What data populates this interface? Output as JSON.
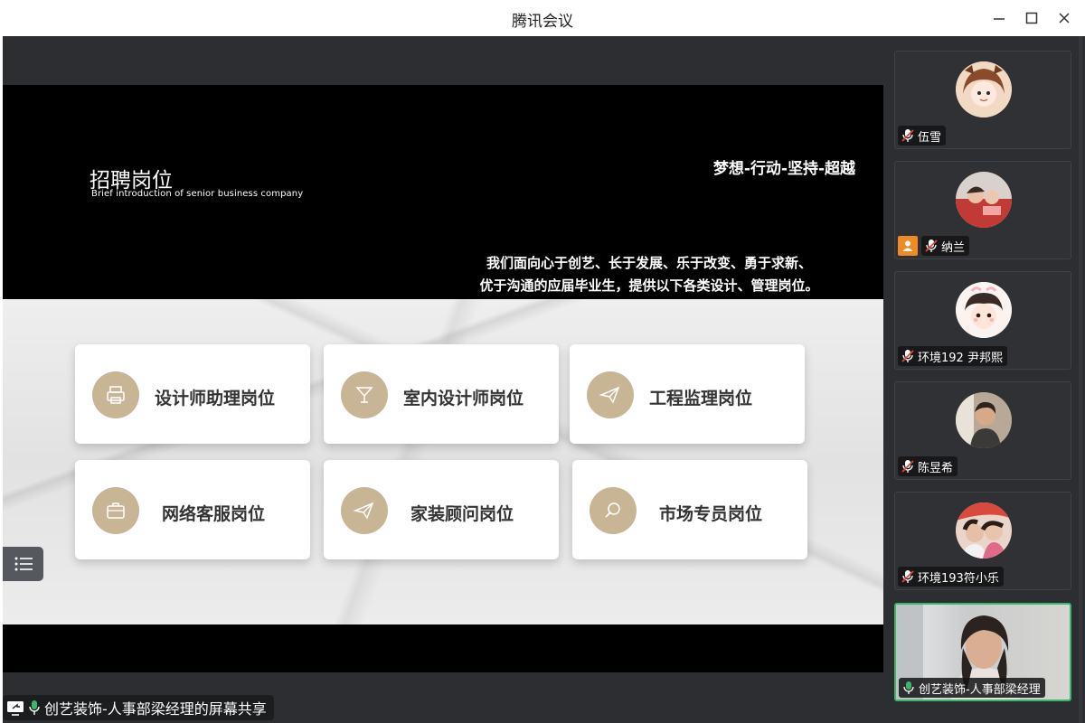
{
  "window": {
    "title": "腾讯会议"
  },
  "slide": {
    "title": "招聘岗位",
    "subtitle": "Brief introduction of senior business company",
    "motto": "梦想-行动-坚持-超越",
    "intro_line1": "我们面向心于创艺、长于发展、乐于改变、勇于求新、",
    "intro_line2": "优于沟通的应届毕业生，提供以下各类设计、管理岗位。",
    "cards": [
      {
        "label": "设计师助理岗位",
        "icon": "printer-icon"
      },
      {
        "label": "室内设计师岗位",
        "icon": "cocktail-glass-icon"
      },
      {
        "label": "工程监理岗位",
        "icon": "paper-plane-icon"
      },
      {
        "label": "网络客服岗位",
        "icon": "briefcase-icon"
      },
      {
        "label": "家装顾问岗位",
        "icon": "paper-plane-icon"
      },
      {
        "label": "市场专员岗位",
        "icon": "search-icon"
      }
    ],
    "accent_color": "#c8b596"
  },
  "share": {
    "label": "创艺装饰-人事部梁经理的屏幕共享"
  },
  "participants": [
    {
      "name": "伍雪",
      "muted": true
    },
    {
      "name": "纳兰",
      "muted": true
    },
    {
      "name": "环境192 尹邦熙",
      "muted": true
    },
    {
      "name": "陈昱希",
      "muted": true
    },
    {
      "name": "环境193符小乐",
      "muted": true
    },
    {
      "name": "创艺装饰-人事部梁经理",
      "muted": false,
      "active": true
    }
  ],
  "colors": {
    "active_border": "#37b86a",
    "mic_on": "#37b86a",
    "mic_off": "#e0463c"
  }
}
